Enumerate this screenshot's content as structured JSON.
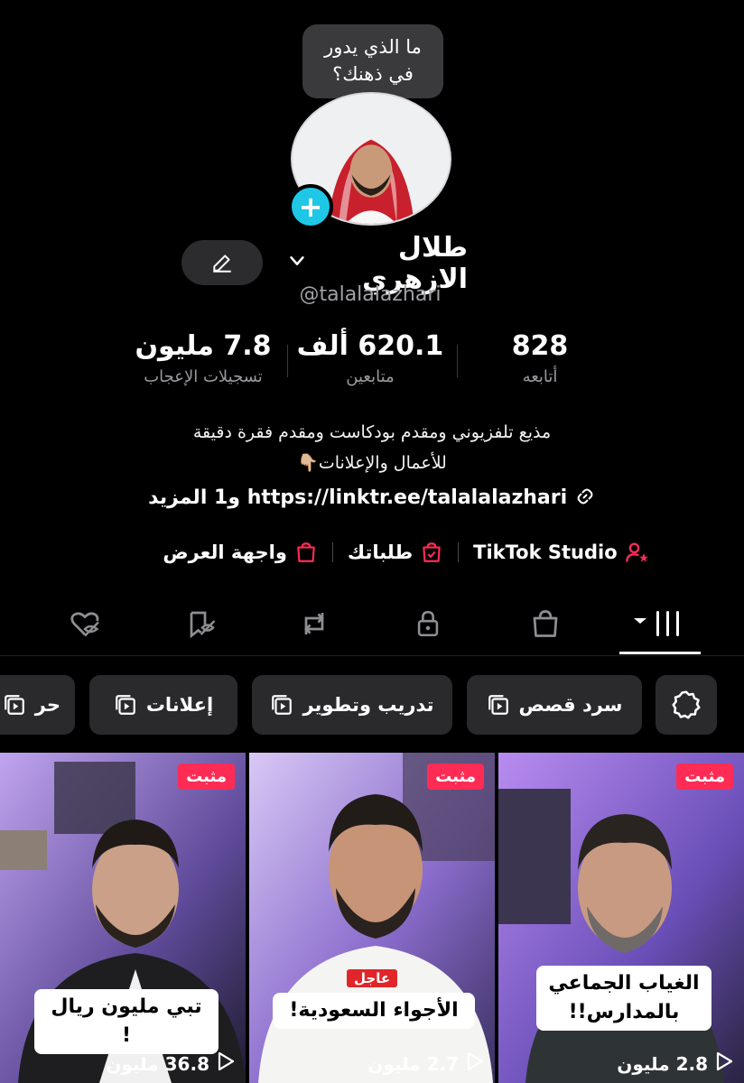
{
  "profile": {
    "bubble_line1": "ما الذي يدور",
    "bubble_line2": "في ذهنك؟",
    "name": "طلال الازهري",
    "handle": "@talalalazhari"
  },
  "stats": {
    "following_value": "828",
    "following_label": "أتابعه",
    "followers_value": "620.1 ألف",
    "followers_label": "متابعين",
    "likes_value": "7.8 مليون",
    "likes_label": "تسجيلات الإعجاب"
  },
  "bio": {
    "line1": "مذيع تلفزيوني ومقدم بودكاست ومقدم فقرة دقيقة",
    "line2": "للأعمال والإعلانات👇🏼",
    "link": "https://linktr.ee/talalalazhari و1 المزيد"
  },
  "tools": {
    "studio": "TikTok Studio",
    "orders": "طلباتك",
    "showcase": "واجهة العرض"
  },
  "chips": [
    "سرد قصص",
    "تدريب وتطوير",
    "إعلانات",
    "حر"
  ],
  "videos": [
    {
      "pinned": "مثبت",
      "caption_line1": "الغياب الجماعي",
      "caption_line2": "بالمدارس!!",
      "views": "2.8 مليون"
    },
    {
      "pinned": "مثبت",
      "urgent": "عاجل",
      "caption_line1": "الأجواء السعودية!",
      "views": "2.7 مليون"
    },
    {
      "pinned": "مثبت",
      "caption_line1": "تبي مليون ريال !",
      "views": "36.8 مليون"
    }
  ],
  "colors": {
    "accent": "#fe2c55",
    "add": "#1fc7e6",
    "chip": "#2a2a2c"
  }
}
